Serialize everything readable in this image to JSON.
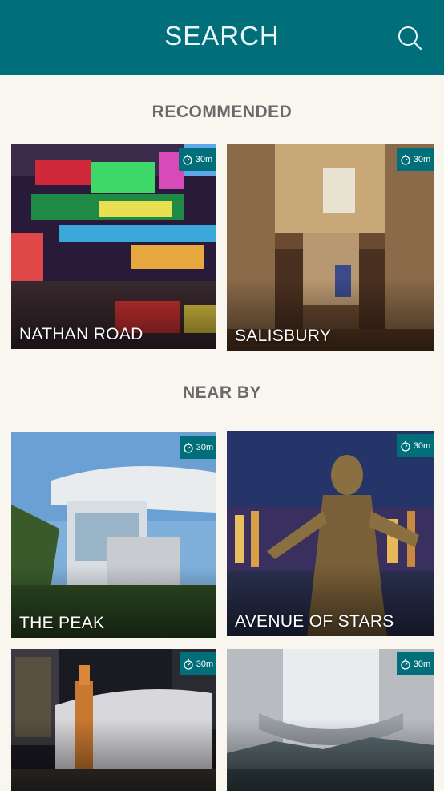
{
  "header": {
    "title": "SEARCH",
    "search_icon": "search-icon"
  },
  "sections": {
    "recommended": "RECOMMENDED",
    "nearby": "NEAR BY"
  },
  "cards": [
    {
      "label": "NATHAN ROAD",
      "duration": "30m"
    },
    {
      "label": "SALISBURY",
      "duration": "30m"
    },
    {
      "label": "THE PEAK",
      "duration": "30m"
    },
    {
      "label": "AVENUE OF STARS",
      "duration": "30m"
    },
    {
      "label": "",
      "duration": "30m"
    },
    {
      "label": "",
      "duration": "30m"
    }
  ],
  "colors": {
    "brand": "#006f79",
    "background": "#f8f6ef",
    "section_text": "#6a6a6a"
  }
}
